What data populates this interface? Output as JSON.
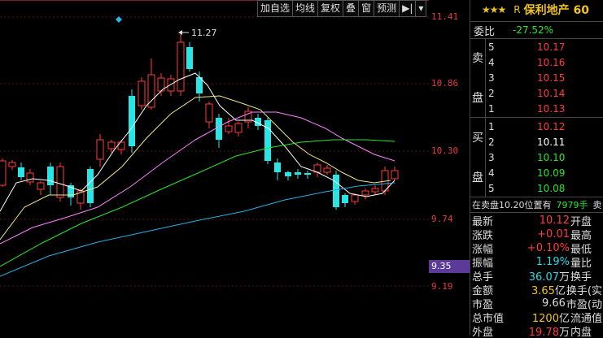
{
  "toolbar": {
    "buttons": [
      "加自选",
      "均线",
      "复权",
      "叠",
      "窗",
      "预测"
    ],
    "more": "▾"
  },
  "axis": {
    "labels": [
      "11.41",
      "10.86",
      "10.30",
      "9.74",
      "9.19"
    ],
    "current": "9.35"
  },
  "chart_annotation": {
    "high_label": "11.27"
  },
  "stock": {
    "stars": "★★★",
    "r_mark": "R",
    "name": "保利地产 60"
  },
  "weibi": {
    "label": "委比",
    "value": "-27.52%"
  },
  "sell_label": [
    "卖",
    "盘"
  ],
  "buy_label": [
    "买",
    "盘"
  ],
  "sell_levels": [
    {
      "n": "5",
      "price": "10.17"
    },
    {
      "n": "4",
      "price": "10.16"
    },
    {
      "n": "3",
      "price": "10.15"
    },
    {
      "n": "2",
      "price": "10.14"
    },
    {
      "n": "1",
      "price": "10.13"
    }
  ],
  "buy_levels": [
    {
      "n": "1",
      "price": "10.12",
      "color": "#ff3b3b"
    },
    {
      "n": "2",
      "price": "10.11",
      "color": "#ffffff"
    },
    {
      "n": "3",
      "price": "10.10",
      "color": "#29e629"
    },
    {
      "n": "4",
      "price": "10.09",
      "color": "#29e629"
    },
    {
      "n": "5",
      "price": "10.08",
      "color": "#29e629"
    }
  ],
  "note": {
    "text": "在卖盘10.20位置有",
    "vol": "7979手",
    "tail": "卖"
  },
  "stats": [
    {
      "l": "最新",
      "v": "10.12",
      "c": "#ff3b3b",
      "u": "",
      "l2": "开盘"
    },
    {
      "l": "涨跌",
      "v": "+0.01",
      "c": "#ff3b3b",
      "u": "",
      "l2": "最高"
    },
    {
      "l": "涨幅",
      "v": "+0.10%",
      "c": "#ff3b3b",
      "u": "",
      "l2": "最低"
    },
    {
      "l": "振幅",
      "v": "1.19%",
      "c": "#29d9e6",
      "u": "",
      "l2": "量比"
    },
    {
      "l": "总手",
      "v": "36.07",
      "c": "#29d9e6",
      "u": "万",
      "l2": "换手"
    },
    {
      "l": "金额",
      "v": "3.65",
      "c": "#f0c419",
      "u": "亿",
      "l2": "换手(实"
    },
    {
      "l": "市盈",
      "v": "9.66",
      "c": "#ddd",
      "u": "",
      "l2": "市盈(动"
    },
    {
      "l": "总市值",
      "v": "1200",
      "c": "#f0c419",
      "u": "亿",
      "l2": "流通值"
    },
    {
      "l": "外盘",
      "v": "19.78",
      "c": "#ff3b3b",
      "u": "万",
      "l2": "内盘"
    }
  ],
  "colors": {
    "up": "#ff3b3b",
    "down": "#29e6e6",
    "ma5": "#ffffff",
    "ma10": "#f0e68c",
    "ma20": "#ff7fff",
    "ma30": "#29e629",
    "ma60": "#29b0e6"
  }
}
